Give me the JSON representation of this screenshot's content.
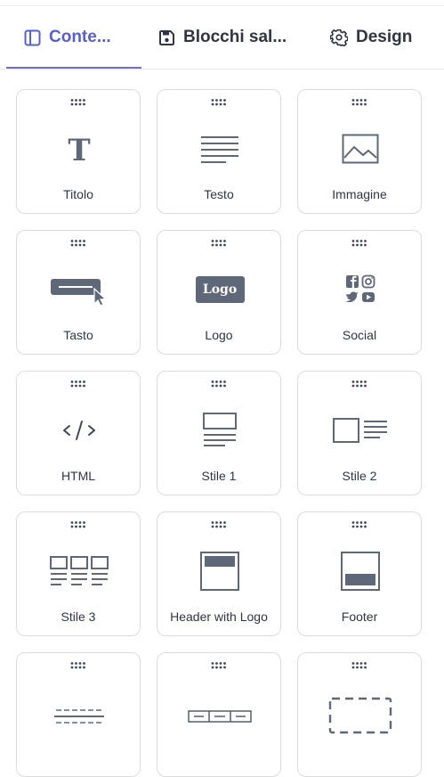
{
  "tabs": [
    {
      "label": "Conte...",
      "icon": "sidebar-panel-icon",
      "active": true
    },
    {
      "label": "Blocchi sal...",
      "icon": "save-icon",
      "active": false
    },
    {
      "label": "Design",
      "icon": "gear-icon",
      "active": false
    }
  ],
  "blocks": [
    {
      "label": "Titolo",
      "icon": "title-icon"
    },
    {
      "label": "Testo",
      "icon": "text-icon"
    },
    {
      "label": "Immagine",
      "icon": "image-icon"
    },
    {
      "label": "Tasto",
      "icon": "button-icon"
    },
    {
      "label": "Logo",
      "icon": "logo-icon",
      "icon_text": "Logo"
    },
    {
      "label": "Social",
      "icon": "social-icon"
    },
    {
      "label": "HTML",
      "icon": "html-code-icon"
    },
    {
      "label": "Stile 1",
      "icon": "style-1-layout-icon"
    },
    {
      "label": "Stile 2",
      "icon": "style-2-layout-icon"
    },
    {
      "label": "Stile 3",
      "icon": "style-3-layout-icon"
    },
    {
      "label": "Header with Logo",
      "icon": "header-with-logo-icon"
    },
    {
      "label": "Footer",
      "icon": "footer-icon"
    },
    {
      "label": "",
      "icon": "divider-icon"
    },
    {
      "label": "",
      "icon": "columns-icon"
    },
    {
      "label": "",
      "icon": "spacer-icon"
    }
  ],
  "colors": {
    "accent": "#5a5fd0",
    "icon": "#5f6878",
    "border": "#d9dce1",
    "text": "#2f3542"
  }
}
